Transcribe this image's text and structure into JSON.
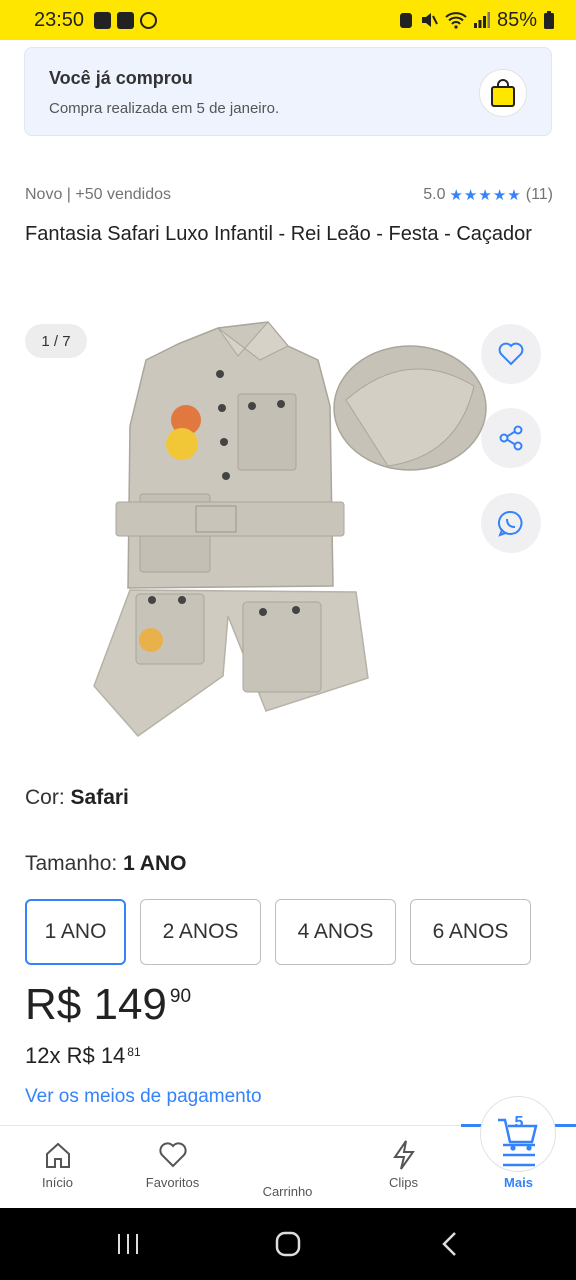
{
  "status_bar": {
    "time": "23:50",
    "battery": "85%"
  },
  "purchase_notice": {
    "title": "Você já comprou",
    "subtitle": "Compra realizada em 5 de janeiro."
  },
  "product": {
    "condition_sold": "Novo  |  +50 vendidos",
    "rating": "5.0",
    "stars": "★★★★★",
    "reviews": "(11)",
    "title": "Fantasia Safari Luxo Infantil - Rei Leão - Festa - Caçador",
    "image_counter": "1 / 7",
    "color_label": "Cor: ",
    "color_value": "Safari",
    "size_label": "Tamanho: ",
    "size_value": "1 ANO",
    "sizes": [
      "1 ANO",
      "2 ANOS",
      "4 ANOS",
      "6 ANOS"
    ],
    "selected_size_index": 0,
    "price_main": "R$ 149",
    "price_cents": "90",
    "installments": "12x R$ 14",
    "installments_cents": "81",
    "payment_link": "Ver os meios de pagamento"
  },
  "bottom_nav": {
    "items": [
      {
        "label": "Início",
        "icon": "home-icon"
      },
      {
        "label": "Favoritos",
        "icon": "heart-icon"
      },
      {
        "label": "Carrinho",
        "icon": "cart-icon"
      },
      {
        "label": "Clips",
        "icon": "lightning-icon"
      },
      {
        "label": "Mais",
        "icon": "menu-icon"
      }
    ],
    "cart_count": "5",
    "active_index": 4
  },
  "colors": {
    "accent": "#3483fa",
    "brand_yellow": "#ffe600",
    "outfit": "#c9c5bb"
  }
}
